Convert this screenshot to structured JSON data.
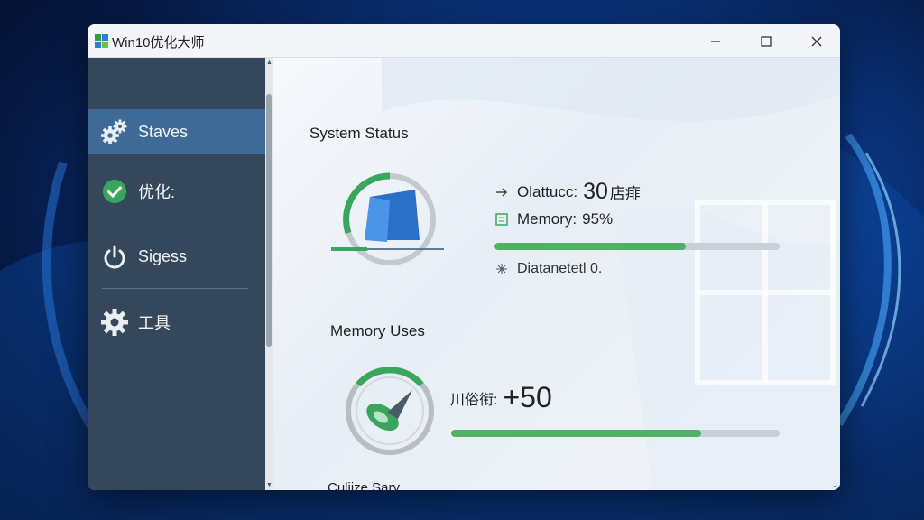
{
  "window": {
    "title": "Win10优化大师"
  },
  "sidebar": {
    "items": [
      {
        "label": "Staves",
        "icon": "gears-icon",
        "active": true
      },
      {
        "label": "优化:",
        "icon": "check-circle-icon",
        "active": false
      },
      {
        "label": "Sigess",
        "icon": "power-icon",
        "active": false
      },
      {
        "label": "工具",
        "icon": "gear-icon",
        "active": false
      }
    ]
  },
  "main": {
    "system_status": {
      "title": "System Status",
      "stat1": {
        "label": "Olattucc:",
        "value": "30",
        "unit": "店痱"
      },
      "stat2": {
        "label": "Memory:",
        "value": "95%"
      },
      "stat2_progress": 0.67,
      "stat3": {
        "label": "Diatanetetl 0."
      }
    },
    "memory_uses": {
      "title": "Memory Uses",
      "stat_label": "川俗衔:",
      "stat_value": "+50",
      "progress": 0.76
    },
    "cutoff_title": "Culiize Sary"
  },
  "colors": {
    "accent_green": "#4fb066",
    "sidebar_bg": "#34475b",
    "sidebar_active": "#3f6a95"
  }
}
